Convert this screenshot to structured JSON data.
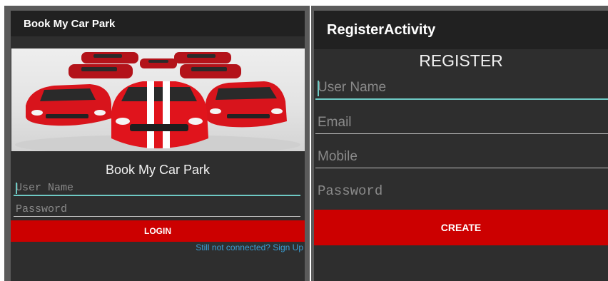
{
  "login_screen": {
    "appbar_title": "Book My Car Park",
    "heading": "Book My Car Park",
    "username_placeholder": "User Name",
    "password_placeholder": "Password",
    "login_label": "LOGIN",
    "signup_link": "Still not connected? Sign Up"
  },
  "register_screen": {
    "appbar_title": "RegisterActivity",
    "heading": "REGISTER",
    "username_placeholder": "User Name",
    "email_placeholder": "Email",
    "mobile_placeholder": "Mobile",
    "password_placeholder": "Password",
    "create_label": "CREATE"
  },
  "colors": {
    "accent": "#6ec9c4",
    "button_red": "#cc0000",
    "link_blue": "#3aa0d6",
    "background": "#2e2e2e",
    "appbar": "#212121"
  }
}
